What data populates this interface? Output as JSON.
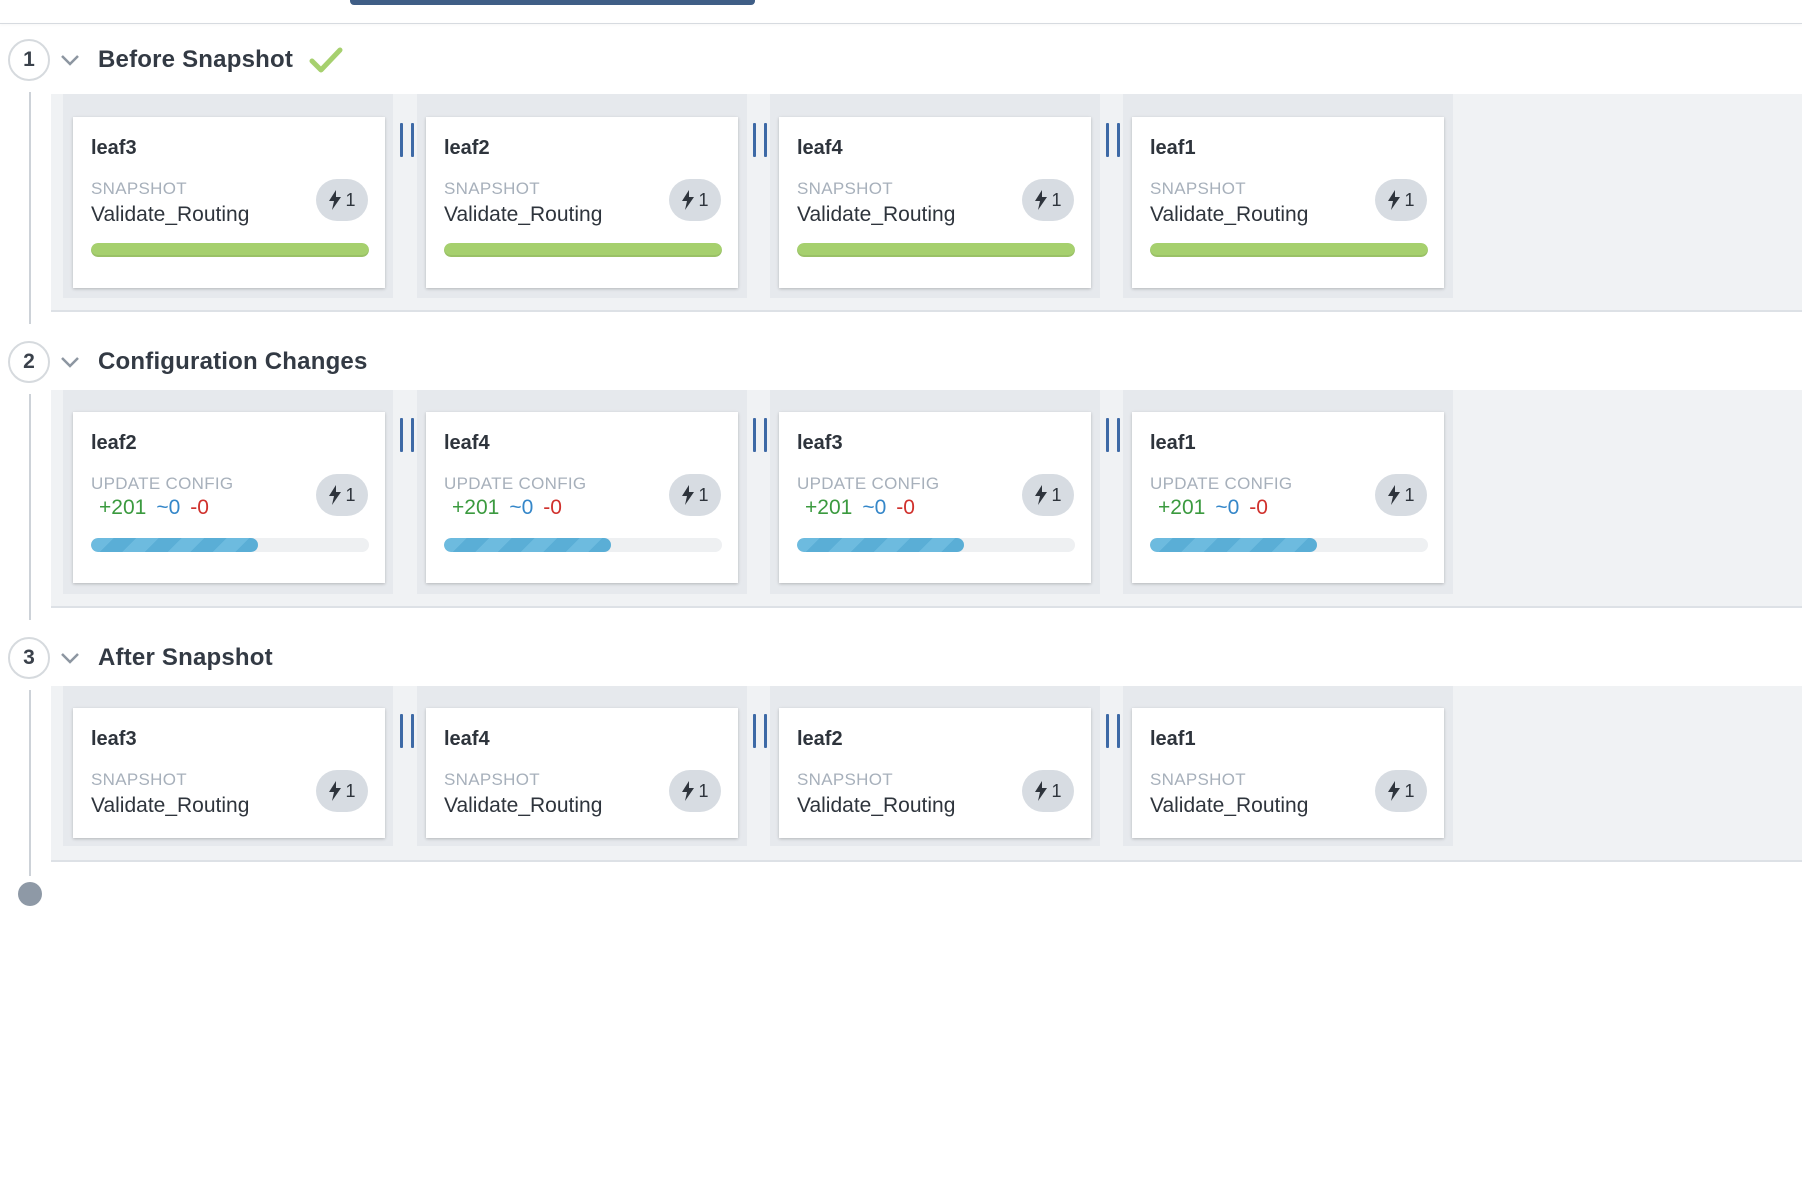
{
  "stages": [
    {
      "number": "1",
      "title": "Before Snapshot",
      "status": "success",
      "cards": [
        {
          "name": "leaf3",
          "kind": "SNAPSHOT",
          "value": "Validate_Routing",
          "events": "1",
          "progress": 1.0
        },
        {
          "name": "leaf2",
          "kind": "SNAPSHOT",
          "value": "Validate_Routing",
          "events": "1",
          "progress": 1.0
        },
        {
          "name": "leaf4",
          "kind": "SNAPSHOT",
          "value": "Validate_Routing",
          "events": "1",
          "progress": 1.0
        },
        {
          "name": "leaf1",
          "kind": "SNAPSHOT",
          "value": "Validate_Routing",
          "events": "1",
          "progress": 1.0
        }
      ]
    },
    {
      "number": "2",
      "title": "Configuration Changes",
      "cards": [
        {
          "name": "leaf2",
          "kind": "UPDATE CONFIG",
          "added": "+201",
          "modified": "~0",
          "removed": "-0",
          "events": "1",
          "progress": 0.6
        },
        {
          "name": "leaf4",
          "kind": "UPDATE CONFIG",
          "added": "+201",
          "modified": "~0",
          "removed": "-0",
          "events": "1",
          "progress": 0.6
        },
        {
          "name": "leaf3",
          "kind": "UPDATE CONFIG",
          "added": "+201",
          "modified": "~0",
          "removed": "-0",
          "events": "1",
          "progress": 0.6
        },
        {
          "name": "leaf1",
          "kind": "UPDATE CONFIG",
          "added": "+201",
          "modified": "~0",
          "removed": "-0",
          "events": "1",
          "progress": 0.6
        }
      ]
    },
    {
      "number": "3",
      "title": "After Snapshot",
      "cards": [
        {
          "name": "leaf3",
          "kind": "SNAPSHOT",
          "value": "Validate_Routing",
          "events": "1"
        },
        {
          "name": "leaf4",
          "kind": "SNAPSHOT",
          "value": "Validate_Routing",
          "events": "1"
        },
        {
          "name": "leaf2",
          "kind": "SNAPSHOT",
          "value": "Validate_Routing",
          "events": "1"
        },
        {
          "name": "leaf1",
          "kind": "SNAPSHOT",
          "value": "Validate_Routing",
          "events": "1"
        }
      ]
    }
  ],
  "colors": {
    "success": "#a6d06e",
    "progress": "#6dbbdf",
    "parallel": "#3e6aa6",
    "diff_added": "#3b9a3f",
    "diff_modified": "#3587c9",
    "diff_removed": "#d0312d"
  },
  "icons": {
    "stage_status": "check-icon",
    "collapse": "chevron-down-icon",
    "event": "lightning-bolt-icon",
    "parallel": "parallel-icon"
  }
}
